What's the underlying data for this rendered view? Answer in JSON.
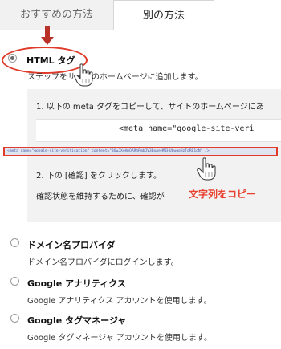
{
  "tabs": {
    "recommended": "おすすめの方法",
    "alternate": "別の方法"
  },
  "options": {
    "html_tag": {
      "title": "HTML タグ",
      "desc": "ステップをサイトのホームページに追加します。"
    },
    "domain": {
      "title": "ドメイン名プロバイダ",
      "desc": "ドメイン名プロバイダにログインします。"
    },
    "analytics": {
      "title": "Google アナリティクス",
      "desc": "Google アナリティクス アカウントを使用します。"
    },
    "tag_manager": {
      "title": "Google タグマネージャ",
      "desc": "Google タグマネージャ アカウントを使用します。"
    }
  },
  "panel": {
    "step1": "1. 以下の meta タグをコピーして、サイトのホームページにあ",
    "code": "<meta name=\"google-site-veri",
    "meta_full": "<meta name=\"google-site-verification\" content=\"3OwJXeHmQARhRmbJV3BxAeHMEHU6wggHzToRB1oN\" />",
    "step2": "2. 下の [確認] をクリックします。",
    "step2_note": "確認状態を維持するために、確認が"
  },
  "annotation": "文字列をコピー",
  "colors": {
    "highlight_red": "#e03a2a",
    "annotation_red": "#e8412f",
    "arrow": "#b8322a"
  },
  "icons": [
    "down-arrow-icon",
    "pointer-hand-icon"
  ]
}
